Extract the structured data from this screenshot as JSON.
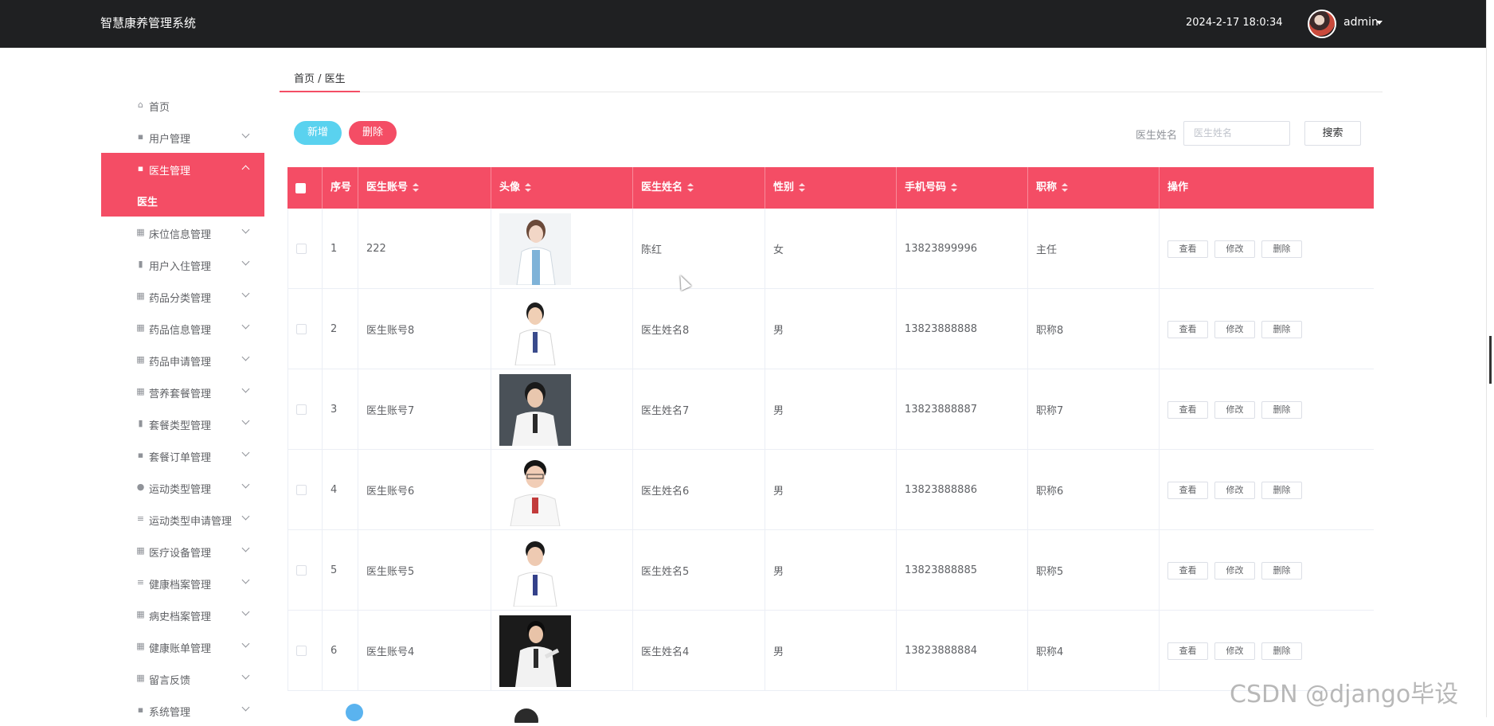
{
  "header": {
    "app_title": "智慧康养管理系统",
    "datetime": "2024-2-17 18:0:34",
    "username": "admin"
  },
  "sidebar": {
    "items": [
      {
        "label": "首页",
        "icon": "home-icon"
      },
      {
        "label": "用户管理",
        "icon": "user-group-icon"
      },
      {
        "label": "医生管理",
        "icon": "doctor-icon",
        "active": true,
        "children": [
          {
            "label": "医生"
          }
        ]
      },
      {
        "label": "床位信息管理",
        "icon": "grid-icon"
      },
      {
        "label": "用户入住管理",
        "icon": "bar-chart-icon"
      },
      {
        "label": "药品分类管理",
        "icon": "apps-icon"
      },
      {
        "label": "药品信息管理",
        "icon": "apps-icon"
      },
      {
        "label": "药品申请管理",
        "icon": "apps-icon"
      },
      {
        "label": "营养套餐管理",
        "icon": "apps-icon"
      },
      {
        "label": "套餐类型管理",
        "icon": "chart-icon"
      },
      {
        "label": "套餐订单管理",
        "icon": "shop-icon"
      },
      {
        "label": "运动类型管理",
        "icon": "person-icon"
      },
      {
        "label": "运动类型申请管理",
        "icon": "sliders-icon"
      },
      {
        "label": "医疗设备管理",
        "icon": "apps-icon"
      },
      {
        "label": "健康档案管理",
        "icon": "list-icon"
      },
      {
        "label": "病史档案管理",
        "icon": "apps-icon"
      },
      {
        "label": "健康账单管理",
        "icon": "apps-icon"
      },
      {
        "label": "留言反馈",
        "icon": "apps-icon"
      },
      {
        "label": "系统管理",
        "icon": "clipboard-icon"
      }
    ]
  },
  "breadcrumb": {
    "text": "首页 / 医生"
  },
  "toolbar": {
    "add_label": "新增",
    "delete_label": "删除",
    "search_label": "医生姓名",
    "search_placeholder": "医生姓名",
    "search_button": "搜索"
  },
  "table": {
    "columns": [
      "序号",
      "医生账号",
      "头像",
      "医生姓名",
      "性别",
      "手机号码",
      "职称",
      "操作"
    ],
    "rows": [
      {
        "index": "1",
        "account": "222",
        "name": "陈红",
        "gender": "女",
        "phone": "13823899996",
        "title": "主任"
      },
      {
        "index": "2",
        "account": "医生账号8",
        "name": "医生姓名8",
        "gender": "男",
        "phone": "13823888888",
        "title": "职称8"
      },
      {
        "index": "3",
        "account": "医生账号7",
        "name": "医生姓名7",
        "gender": "男",
        "phone": "13823888887",
        "title": "职称7"
      },
      {
        "index": "4",
        "account": "医生账号6",
        "name": "医生姓名6",
        "gender": "男",
        "phone": "13823888886",
        "title": "职称6"
      },
      {
        "index": "5",
        "account": "医生账号5",
        "name": "医生姓名5",
        "gender": "男",
        "phone": "13823888885",
        "title": "职称5"
      },
      {
        "index": "6",
        "account": "医生账号4",
        "name": "医生姓名4",
        "gender": "男",
        "phone": "13823888884",
        "title": "职称4"
      }
    ],
    "actions": [
      "查看",
      "修改",
      "删除"
    ]
  },
  "watermark": "CSDN @django毕设",
  "colors": {
    "accent": "#f44d65",
    "add_button": "#5ad2ef",
    "topbar": "#1f2022"
  }
}
